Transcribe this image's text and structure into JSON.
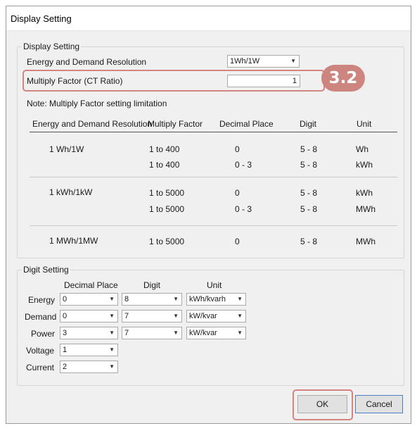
{
  "window": {
    "title": "Display Setting"
  },
  "display_group": {
    "legend": "Display Setting",
    "resolution_label": "Energy and Demand Resolution",
    "resolution_value": "1Wh/1W",
    "multiply_label": "Multiply Factor (CT Ratio)",
    "multiply_value": "1",
    "note": "Note: Multiply Factor setting limitation"
  },
  "annotation": {
    "step": "3.2"
  },
  "limitation_table": {
    "headers": [
      "Energy and Demand Resolution",
      "Multiply Factor",
      "Decimal Place",
      "Digit",
      "Unit"
    ],
    "groups": [
      {
        "resolution": "1 Wh/1W",
        "rows": [
          {
            "factor": "1 to 400",
            "decimal": "0",
            "digit": "5 - 8",
            "unit": "Wh"
          },
          {
            "factor": "1 to 400",
            "decimal": "0 - 3",
            "digit": "5 - 8",
            "unit": "kWh"
          }
        ]
      },
      {
        "resolution": "1 kWh/1kW",
        "rows": [
          {
            "factor": "1 to 5000",
            "decimal": "0",
            "digit": "5 - 8",
            "unit": "kWh"
          },
          {
            "factor": "1 to 5000",
            "decimal": "0 - 3",
            "digit": "5 - 8",
            "unit": "MWh"
          }
        ]
      },
      {
        "resolution": "1 MWh/1MW",
        "rows": [
          {
            "factor": "1 to 5000",
            "decimal": "0",
            "digit": "5 - 8",
            "unit": "MWh"
          }
        ]
      }
    ]
  },
  "digit_group": {
    "legend": "Digit Setting",
    "col_decimal": "Decimal Place",
    "col_digit": "Digit",
    "col_unit": "Unit",
    "rows": [
      {
        "label": "Energy",
        "decimal": "0",
        "digit": "8",
        "unit": "kWh/kvarh"
      },
      {
        "label": "Demand",
        "decimal": "0",
        "digit": "7",
        "unit": "kW/kvar"
      },
      {
        "label": "Power",
        "decimal": "3",
        "digit": "7",
        "unit": "kW/kvar"
      },
      {
        "label": "Voltage",
        "decimal": "1"
      },
      {
        "label": "Current",
        "decimal": "2"
      }
    ]
  },
  "buttons": {
    "ok": "OK",
    "cancel": "Cancel"
  },
  "colors": {
    "highlight": "#d4847e",
    "badge": "#cd8580",
    "default_button_border": "#4a7fc1"
  }
}
